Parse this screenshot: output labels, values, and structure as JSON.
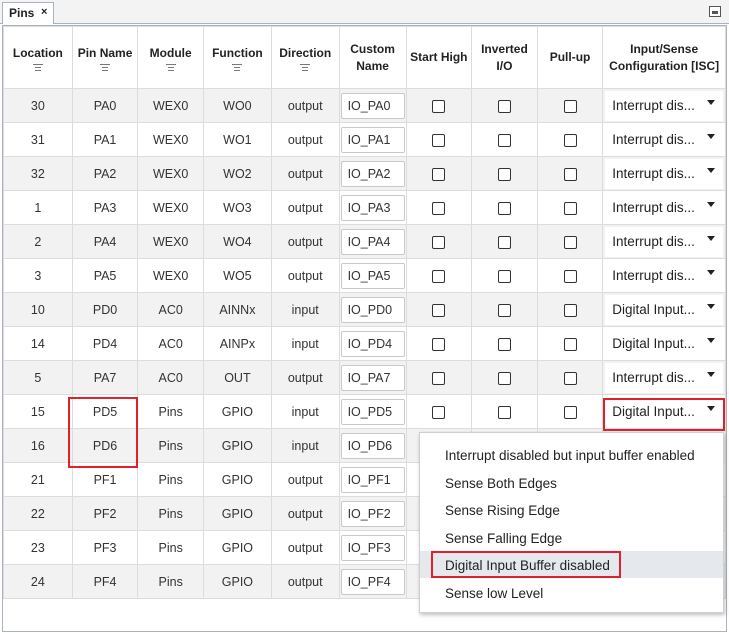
{
  "tab": {
    "label": "Pins",
    "close_glyph": "×"
  },
  "columns": [
    {
      "key": "location",
      "label": "Location"
    },
    {
      "key": "pin_name",
      "label": "Pin Name"
    },
    {
      "key": "module",
      "label": "Module"
    },
    {
      "key": "function",
      "label": "Function"
    },
    {
      "key": "direction",
      "label": "Direction"
    },
    {
      "key": "custom_name",
      "label": "Custom Name"
    },
    {
      "key": "start_high",
      "label": "Start High"
    },
    {
      "key": "inverted",
      "label": "Inverted I/O"
    },
    {
      "key": "pullup",
      "label": "Pull-up"
    },
    {
      "key": "isc",
      "label": "Input/Sense Configuration [ISC]"
    }
  ],
  "rows": [
    {
      "location": "30",
      "pin_name": "PA0",
      "module": "WEX0",
      "function": "WO0",
      "direction": "output",
      "custom_name": "IO_PA0",
      "start_high": false,
      "inverted": false,
      "pullup": false,
      "isc": "Interrupt dis..."
    },
    {
      "location": "31",
      "pin_name": "PA1",
      "module": "WEX0",
      "function": "WO1",
      "direction": "output",
      "custom_name": "IO_PA1",
      "start_high": false,
      "inverted": false,
      "pullup": false,
      "isc": "Interrupt dis..."
    },
    {
      "location": "32",
      "pin_name": "PA2",
      "module": "WEX0",
      "function": "WO2",
      "direction": "output",
      "custom_name": "IO_PA2",
      "start_high": false,
      "inverted": false,
      "pullup": false,
      "isc": "Interrupt dis..."
    },
    {
      "location": "1",
      "pin_name": "PA3",
      "module": "WEX0",
      "function": "WO3",
      "direction": "output",
      "custom_name": "IO_PA3",
      "start_high": false,
      "inverted": false,
      "pullup": false,
      "isc": "Interrupt dis..."
    },
    {
      "location": "2",
      "pin_name": "PA4",
      "module": "WEX0",
      "function": "WO4",
      "direction": "output",
      "custom_name": "IO_PA4",
      "start_high": false,
      "inverted": false,
      "pullup": false,
      "isc": "Interrupt dis..."
    },
    {
      "location": "3",
      "pin_name": "PA5",
      "module": "WEX0",
      "function": "WO5",
      "direction": "output",
      "custom_name": "IO_PA5",
      "start_high": false,
      "inverted": false,
      "pullup": false,
      "isc": "Interrupt dis..."
    },
    {
      "location": "10",
      "pin_name": "PD0",
      "module": "AC0",
      "function": "AINNx",
      "direction": "input",
      "custom_name": "IO_PD0",
      "start_high": false,
      "inverted": false,
      "pullup": false,
      "isc": "Digital Input..."
    },
    {
      "location": "14",
      "pin_name": "PD4",
      "module": "AC0",
      "function": "AINPx",
      "direction": "input",
      "custom_name": "IO_PD4",
      "start_high": false,
      "inverted": false,
      "pullup": false,
      "isc": "Digital Input..."
    },
    {
      "location": "5",
      "pin_name": "PA7",
      "module": "AC0",
      "function": "OUT",
      "direction": "output",
      "custom_name": "IO_PA7",
      "start_high": false,
      "inverted": false,
      "pullup": false,
      "isc": "Interrupt dis..."
    },
    {
      "location": "15",
      "pin_name": "PD5",
      "module": "Pins",
      "function": "GPIO",
      "direction": "input",
      "custom_name": "IO_PD5",
      "start_high": false,
      "inverted": false,
      "pullup": false,
      "isc": "Digital Input..."
    },
    {
      "location": "16",
      "pin_name": "PD6",
      "module": "Pins",
      "function": "GPIO",
      "direction": "input",
      "custom_name": "IO_PD6",
      "start_high": null,
      "inverted": null,
      "pullup": null,
      "isc": null
    },
    {
      "location": "21",
      "pin_name": "PF1",
      "module": "Pins",
      "function": "GPIO",
      "direction": "output",
      "custom_name": "IO_PF1",
      "start_high": null,
      "inverted": null,
      "pullup": null,
      "isc": null
    },
    {
      "location": "22",
      "pin_name": "PF2",
      "module": "Pins",
      "function": "GPIO",
      "direction": "output",
      "custom_name": "IO_PF2",
      "start_high": null,
      "inverted": null,
      "pullup": null,
      "isc": null
    },
    {
      "location": "23",
      "pin_name": "PF3",
      "module": "Pins",
      "function": "GPIO",
      "direction": "output",
      "custom_name": "IO_PF3",
      "start_high": null,
      "inverted": null,
      "pullup": null,
      "isc": null
    },
    {
      "location": "24",
      "pin_name": "PF4",
      "module": "Pins",
      "function": "GPIO",
      "direction": "output",
      "custom_name": "IO_PF4",
      "start_high": null,
      "inverted": null,
      "pullup": null,
      "isc": null
    }
  ],
  "dropdown_menu": {
    "items": [
      "Interrupt disabled but input buffer enabled",
      "Sense Both Edges",
      "Sense Rising Edge",
      "Sense Falling Edge",
      "Digital Input Buffer disabled",
      "Sense low Level"
    ],
    "highlighted": "Digital Input Buffer disabled"
  },
  "colors": {
    "highlight": "#e0202a",
    "row_alt": "#f2f2f2",
    "menu_hover": "#e5e8ec"
  }
}
